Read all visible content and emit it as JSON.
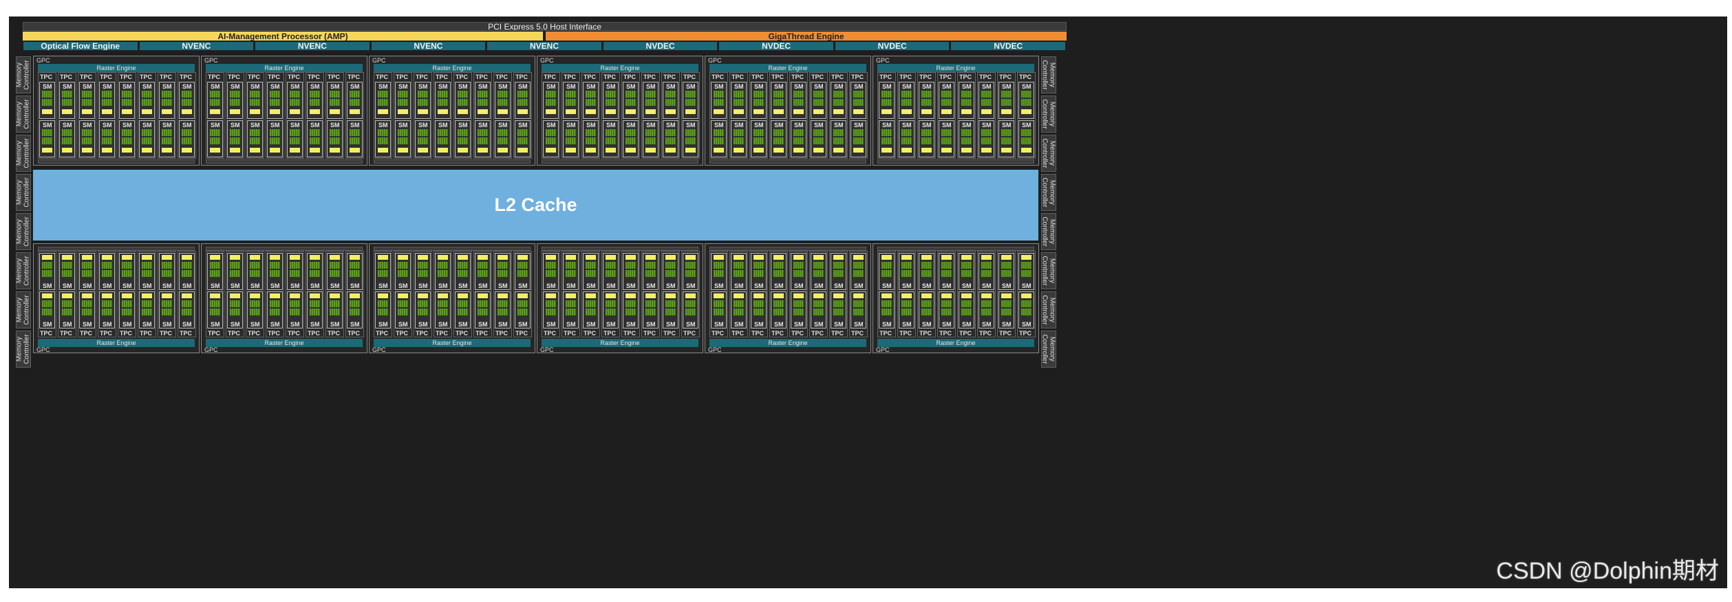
{
  "host_interface": "PCI Express 5.0 Host Interface",
  "amp": "AI-Management Processor (AMP)",
  "gigathread": "GigaThread Engine",
  "engines": [
    "Optical Flow Engine",
    "NVENC",
    "NVENC",
    "NVENC",
    "NVENC",
    "NVDEC",
    "NVDEC",
    "NVDEC",
    "NVDEC"
  ],
  "l2_cache": "L2 Cache",
  "memory_controller": "Memory\nController",
  "gpc_label": "GPC",
  "raster_engine": "Raster Engine",
  "tpc_label": "TPC",
  "sm_label": "SM",
  "watermark": "CSDN @Dolphin期材",
  "counts": {
    "gpcs_per_row": 6,
    "tpcs_per_gpc": 8,
    "sms_per_tpc": 2,
    "memory_controllers_per_side": 8
  },
  "colors": {
    "background": "#1e1e1e",
    "amp": "#f5d65a",
    "gigathread": "#ef8d34",
    "engine": "#1c6a78",
    "l2_cache": "#6fb0de",
    "cuda_cores": "#5e9d1e",
    "cache_block": "#f1ef6a"
  }
}
